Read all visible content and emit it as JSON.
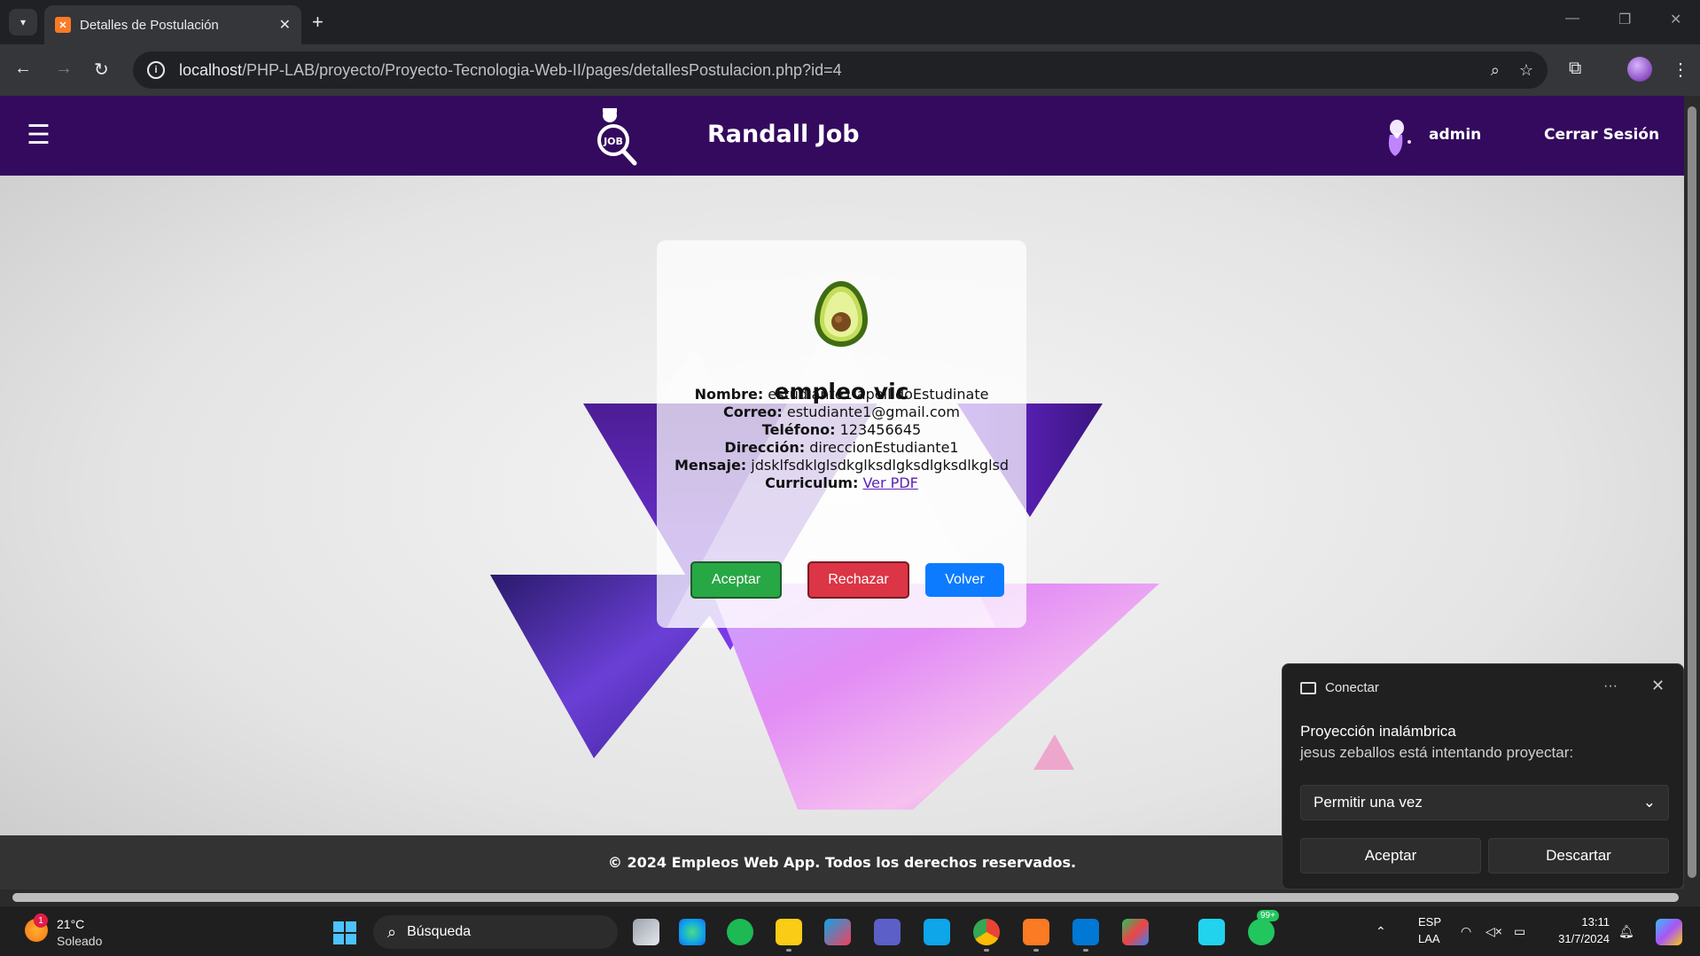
{
  "browser": {
    "tab_title": "Detalles de Postulación",
    "url_host": "localhost",
    "url_path": "/PHP-LAB/proyecto/Proyecto-Tecnologia-Web-II/pages/detallesPostulacion.php?id=4"
  },
  "header": {
    "brand": "Randall Job",
    "user": "admin",
    "logout": "Cerrar Sesión"
  },
  "card": {
    "title": "empleo vic",
    "fields": [
      {
        "label": "Nombre:",
        "value": " estudiante1 apellidoEstudinate"
      },
      {
        "label": "Correo:",
        "value": " estudiante1@gmail.com"
      },
      {
        "label": "Teléfono:",
        "value": " 123456645"
      },
      {
        "label": "Dirección:",
        "value": " direccionEstudiante1"
      },
      {
        "label": "Mensaje:",
        "value": " jdsklfsdklglsdkglksdlgksdlgksdlkglsd"
      }
    ],
    "curriculum_label": "Curriculum:",
    "curriculum_link": "Ver PDF",
    "buttons": {
      "accept": "Aceptar",
      "reject": "Rechazar",
      "back": "Volver"
    }
  },
  "footer": "© 2024 Empleos Web App. Todos los derechos reservados.",
  "notification": {
    "header": "Conectar",
    "dots": "···",
    "title": "Proyección inalámbrica",
    "subtitle": "jesus zeballos está intentando proyectar:",
    "select_value": "Permitir una vez",
    "accept": "Aceptar",
    "dismiss": "Descartar"
  },
  "taskbar": {
    "weather_temp": "21°C",
    "weather_cond": "Soleado",
    "weather_badge": "1",
    "search_placeholder": "Búsqueda",
    "whatsapp_badge": "99+",
    "lang_1": "ESP",
    "lang_2": "LAA",
    "time": "13:11",
    "date": "31/7/2024"
  },
  "colors": {
    "header_bg": "#330a5e",
    "accept": "#28a745",
    "reject": "#dc3545",
    "back": "#0d7bff"
  }
}
